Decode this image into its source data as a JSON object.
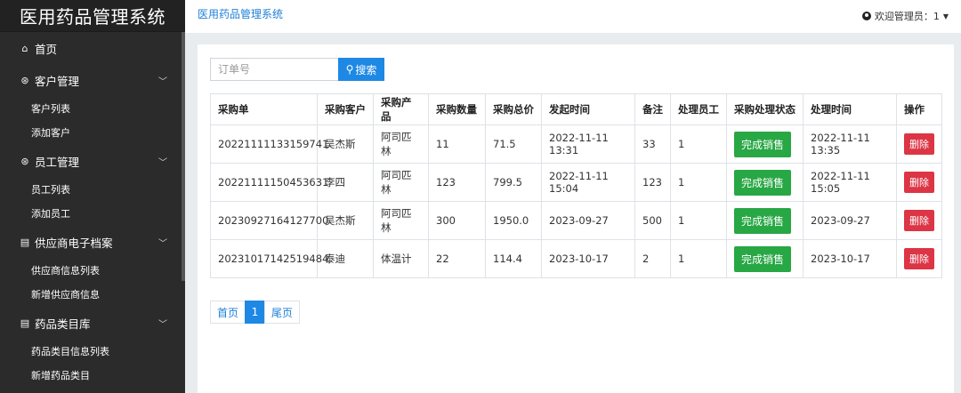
{
  "sidebar": {
    "brand": "医用药品管理系统",
    "items": [
      {
        "icon": "home-icon",
        "glyph": "⌂",
        "label": "首页",
        "has_chevron": false,
        "subitems": []
      },
      {
        "icon": "users-icon",
        "glyph": "⊛",
        "label": "客户管理",
        "has_chevron": true,
        "subitems": [
          "客户列表",
          "添加客户"
        ]
      },
      {
        "icon": "users-icon",
        "glyph": "⊛",
        "label": "员工管理",
        "has_chevron": true,
        "subitems": [
          "员工列表",
          "添加员工"
        ]
      },
      {
        "icon": "file-icon",
        "glyph": "▤",
        "label": "供应商电子档案",
        "has_chevron": true,
        "subitems": [
          "供应商信息列表",
          "新增供应商信息"
        ]
      },
      {
        "icon": "file-icon",
        "glyph": "▤",
        "label": "药品类目库",
        "has_chevron": true,
        "subitems": [
          "药品类目信息列表",
          "新增药品类目"
        ]
      }
    ]
  },
  "topbar": {
    "title": "医用药品管理系统",
    "user_label": "欢迎管理员：1"
  },
  "search": {
    "placeholder": "订单号",
    "button_label": "搜索"
  },
  "table": {
    "columns": [
      "采购单",
      "采购客户",
      "采购产品",
      "采购数量",
      "采购总价",
      "发起时间",
      "备注",
      "处理员工",
      "采购处理状态",
      "处理时间",
      "操作"
    ],
    "rows": [
      {
        "order": "20221111133159741",
        "customer": "吴杰斯",
        "product": "阿司匹林",
        "qty": "11",
        "total": "71.5",
        "start": "2022-11-11 13:31",
        "note": "33",
        "staff": "1",
        "status": "完成销售",
        "handled": "2022-11-11 13:35",
        "action": "删除"
      },
      {
        "order": "20221111150453631",
        "customer": "李四",
        "product": "阿司匹林",
        "qty": "123",
        "total": "799.5",
        "start": "2022-11-11 15:04",
        "note": "123",
        "staff": "1",
        "status": "完成销售",
        "handled": "2022-11-11 15:05",
        "action": "删除"
      },
      {
        "order": "20230927164127700",
        "customer": "吴杰斯",
        "product": "阿司匹林",
        "qty": "300",
        "total": "1950.0",
        "start": "2023-09-27",
        "note": "500",
        "staff": "1",
        "status": "完成销售",
        "handled": "2023-09-27",
        "action": "删除"
      },
      {
        "order": "20231017142519484",
        "customer": "泰迪",
        "product": "体温计",
        "qty": "22",
        "total": "114.4",
        "start": "2023-10-17",
        "note": "2",
        "staff": "1",
        "status": "完成销售",
        "handled": "2023-10-17",
        "action": "删除"
      }
    ]
  },
  "pager": {
    "first": "首页",
    "current": "1",
    "last": "尾页"
  },
  "colors": {
    "sidebar_bg": "#2b2b2b",
    "brand_bg": "#222222",
    "accent": "#1e88e5",
    "success": "#28a745",
    "danger": "#dc3545"
  }
}
